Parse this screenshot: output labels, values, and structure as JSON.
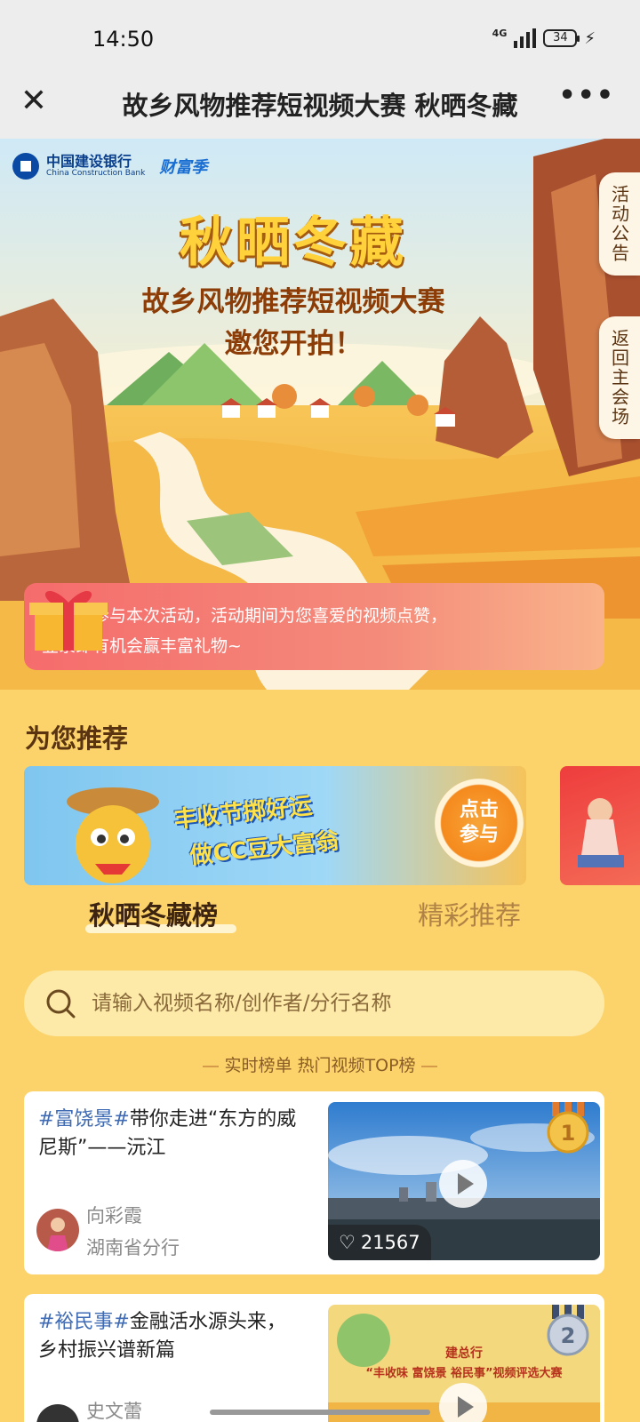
{
  "status": {
    "time": "14:50",
    "network": "4G",
    "battery": "34"
  },
  "nav": {
    "title": "故乡风物推荐短视频大赛 秋晒冬藏"
  },
  "hero": {
    "brand_cn": "中国建设银行",
    "brand_en": "China Construction Bank",
    "brand_tag": "财富季",
    "title": "秋晒冬藏",
    "subtitle1": "故乡风物推荐短视频大赛",
    "subtitle2": "邀您开拍！",
    "tab_notice": "活动公告",
    "tab_back": "返回主会场",
    "thanks_line1": "感谢您参与本次活动，活动期间为您喜爱的视频点赞，",
    "thanks_line2": "登录即有机会赢丰富礼物~"
  },
  "recommend": {
    "title": "为您推荐",
    "promo_line1": "丰收节掷好运",
    "promo_line2": "做CC豆大富翁",
    "promo_button": "点击参与"
  },
  "tabs": [
    {
      "label": "秋晒冬藏榜",
      "active": true
    },
    {
      "label": "精彩推荐",
      "active": false
    }
  ],
  "search": {
    "placeholder": "请输入视频名称/创作者/分行名称"
  },
  "ranking": {
    "caption": "实时榜单 热门视频TOP榜"
  },
  "videos": [
    {
      "rank": "1",
      "tag": "#富饶景#",
      "title": "带你走进“东方的威尼斯”——沅江",
      "author": "向彩霞",
      "branch": "湖南省分行",
      "likes": "21567"
    },
    {
      "rank": "2",
      "tag": "#裕民事#",
      "title": "金融活水源头来，乡村振兴谱新篇",
      "author": "史文蕾",
      "branch": "",
      "likes": "",
      "thumb_text": "建总行",
      "thumb_text2": "“丰收味 富饶景 裕民事”视频评选大赛"
    }
  ],
  "colors": {
    "page_bg": "#fcd36a",
    "tag_blue": "#3f6bb4",
    "brown": "#5a3410"
  }
}
